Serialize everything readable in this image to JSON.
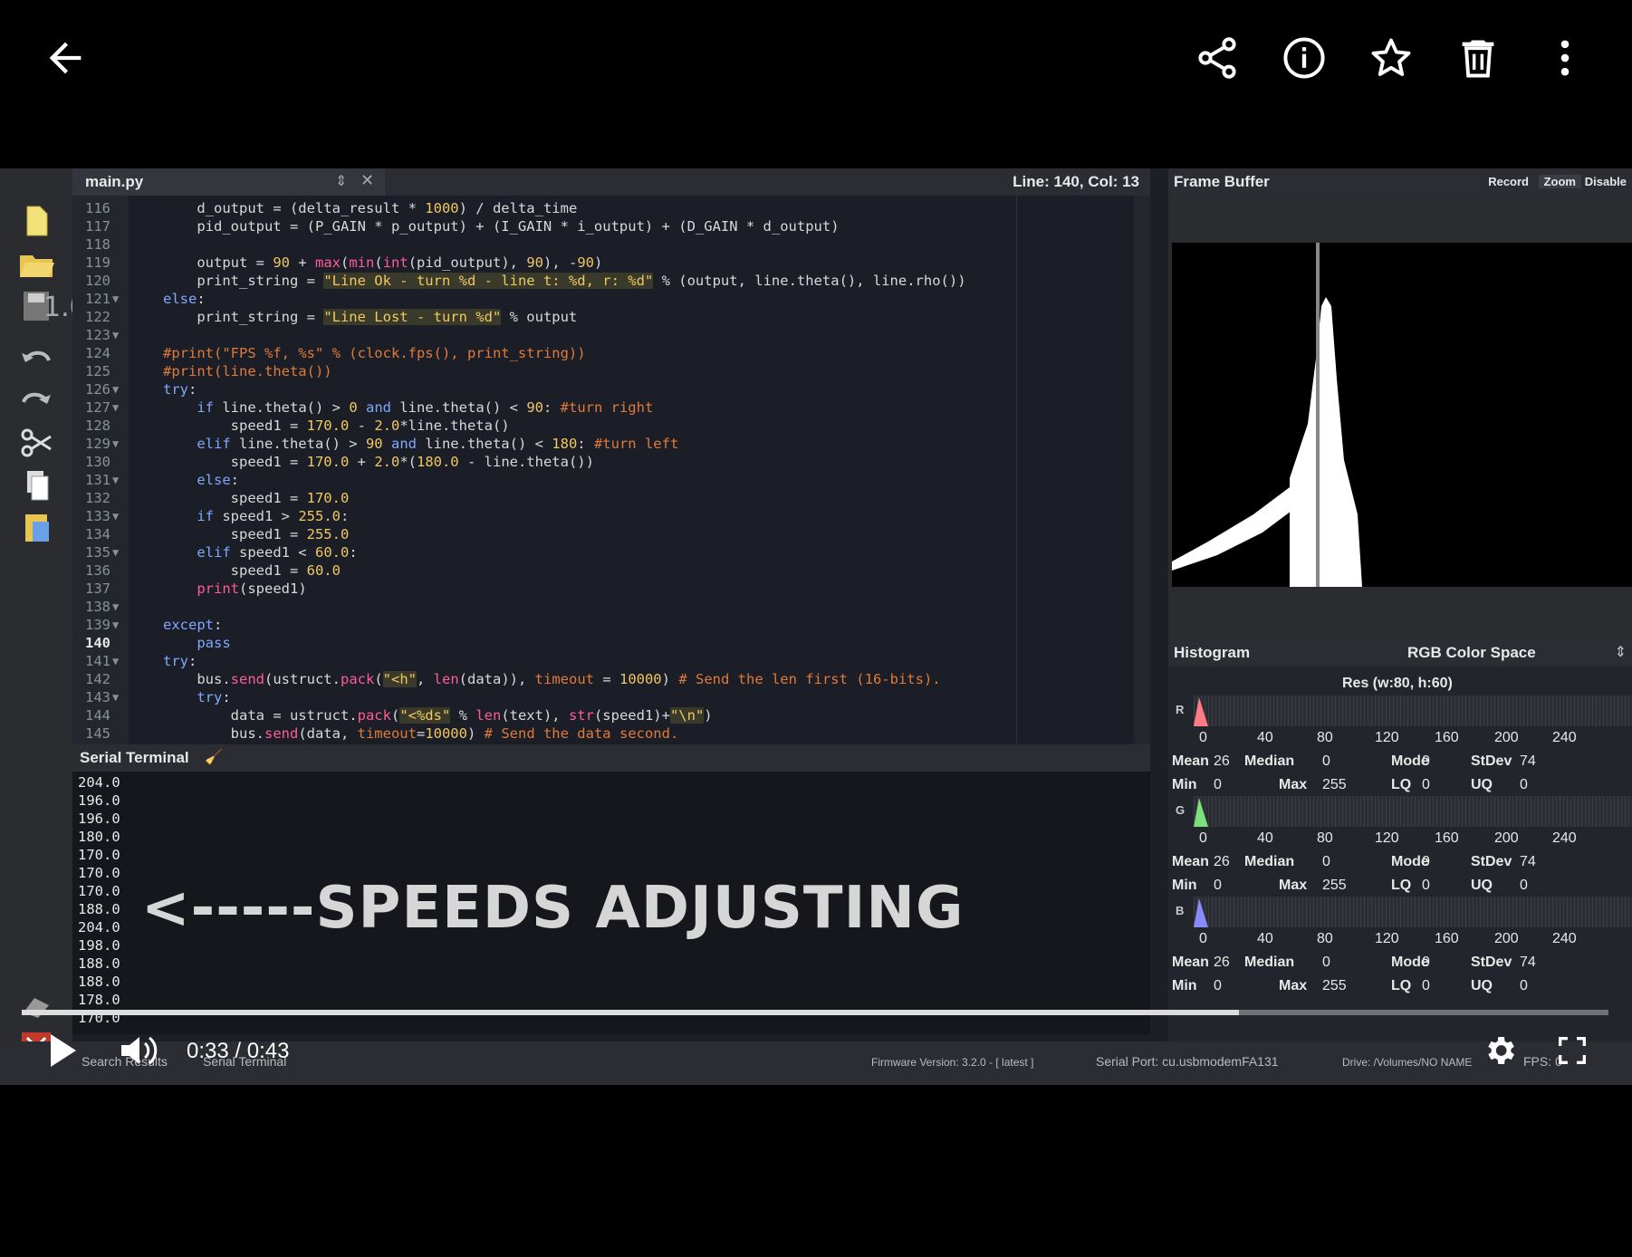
{
  "player": {
    "time": "0:33 / 0:43",
    "progress": 0.767,
    "icons": [
      "back-arrow-icon",
      "share-icon",
      "info-icon",
      "star-icon",
      "trash-icon",
      "more-vert-icon",
      "play-icon",
      "volume-icon",
      "settings-gear-icon",
      "fullscreen-icon"
    ]
  },
  "editor": {
    "tab": "main.py",
    "position": "Line: 140, Col: 13",
    "zoom_label": "1.00",
    "lines": [
      {
        "n": "116",
        "fold": "",
        "code": "    d_output = (delta_result * 1000) / delta_time"
      },
      {
        "n": "117",
        "fold": "",
        "code": "    pid_output = (P_GAIN * p_output) + (I_GAIN * i_output) + (D_GAIN * d_output)"
      },
      {
        "n": "118",
        "fold": "",
        "code": ""
      },
      {
        "n": "119",
        "fold": "",
        "code": "    output = 90 + max(min(int(pid_output), 90), -90)"
      },
      {
        "n": "120",
        "fold": "",
        "code": "    print_string = \"Line Ok - turn %d - line t: %d, r: %d\" % (output, line.theta(), line.rho())"
      },
      {
        "n": "121",
        "fold": "▼",
        "code": "else:"
      },
      {
        "n": "122",
        "fold": "",
        "code": "    print_string = \"Line Lost - turn %d\" % output"
      },
      {
        "n": "123",
        "fold": "▼",
        "code": ""
      },
      {
        "n": "124",
        "fold": "",
        "code": "#print(\"FPS %f, %s\" % (clock.fps(), print_string))"
      },
      {
        "n": "125",
        "fold": "",
        "code": "#print(line.theta())"
      },
      {
        "n": "126",
        "fold": "▼",
        "code": "try:"
      },
      {
        "n": "127",
        "fold": "▼",
        "code": "    if line.theta() > 0 and line.theta() < 90: #turn right"
      },
      {
        "n": "128",
        "fold": "",
        "code": "        speed1 = 170.0 - 2.0*line.theta()"
      },
      {
        "n": "129",
        "fold": "▼",
        "code": "    elif line.theta() > 90 and line.theta() < 180: #turn left"
      },
      {
        "n": "130",
        "fold": "",
        "code": "        speed1 = 170.0 + 2.0*(180.0 - line.theta())"
      },
      {
        "n": "131",
        "fold": "▼",
        "code": "    else:"
      },
      {
        "n": "132",
        "fold": "",
        "code": "        speed1 = 170.0"
      },
      {
        "n": "133",
        "fold": "▼",
        "code": "    if speed1 > 255.0:"
      },
      {
        "n": "134",
        "fold": "",
        "code": "        speed1 = 255.0"
      },
      {
        "n": "135",
        "fold": "▼",
        "code": "    elif speed1 < 60.0:"
      },
      {
        "n": "136",
        "fold": "",
        "code": "        speed1 = 60.0"
      },
      {
        "n": "137",
        "fold": "",
        "code": "    print(speed1)"
      },
      {
        "n": "138",
        "fold": "▼",
        "code": ""
      },
      {
        "n": "139",
        "fold": "▼",
        "code": "except:"
      },
      {
        "n": "140",
        "fold": "",
        "code": "    pass"
      },
      {
        "n": "141",
        "fold": "▼",
        "code": "try:"
      },
      {
        "n": "142",
        "fold": "",
        "code": "    bus.send(ustruct.pack(\"<h\", len(data)), timeout = 10000) # Send the len first (16-bits)."
      },
      {
        "n": "143",
        "fold": "▼",
        "code": "    try:"
      },
      {
        "n": "144",
        "fold": "",
        "code": "        data = ustruct.pack(\"<%ds\" % len(text), str(speed1)+\"\\n\")"
      },
      {
        "n": "145",
        "fold": "",
        "code": "        bus.send(data, timeout=10000) # Send the data second."
      }
    ]
  },
  "terminal": {
    "title": "Serial Terminal",
    "lines": [
      "204.0",
      "196.0",
      "196.0",
      "180.0",
      "170.0",
      "170.0",
      "170.0",
      "188.0",
      "204.0",
      "198.0",
      "188.0",
      "188.0",
      "178.0",
      "170.0"
    ],
    "overlay": "<-----SPEEDS ADJUSTING"
  },
  "framebuffer": {
    "title": "Frame Buffer",
    "buttons": [
      "Record",
      "Zoom",
      "Disable"
    ]
  },
  "histogram": {
    "title": "Histogram",
    "colorspace": "RGB Color Space",
    "res": "Res (w:80, h:60)",
    "ticks": [
      "0",
      "40",
      "80",
      "120",
      "160",
      "200",
      "240"
    ],
    "channels": [
      {
        "label": "R",
        "color": "#ff7b86",
        "mean": "26",
        "median": "0",
        "mode": "0",
        "stdev": "74",
        "min": "0",
        "max": "255",
        "lq": "0",
        "uq": "0"
      },
      {
        "label": "G",
        "color": "#7be07b",
        "mean": "26",
        "median": "0",
        "mode": "0",
        "stdev": "74",
        "min": "0",
        "max": "255",
        "lq": "0",
        "uq": "0"
      },
      {
        "label": "B",
        "color": "#8a8aff",
        "mean": "26",
        "median": "0",
        "mode": "0",
        "stdev": "74",
        "min": "0",
        "max": "255",
        "lq": "0",
        "uq": "0"
      }
    ],
    "stat_labels": {
      "mean": "Mean",
      "median": "Median",
      "mode": "Mode",
      "stdev": "StDev",
      "min": "Min",
      "max": "Max",
      "lq": "LQ",
      "uq": "UQ"
    }
  },
  "statusbar": {
    "search": "Search Results",
    "serial": "Serial Terminal",
    "firmware": "Firmware Version: 3.2.0 - [ latest ]",
    "port": "Serial Port: cu.usbmodemFA131",
    "drive": "Drive: /Volumes/NO NAME",
    "fps": "FPS: 0"
  }
}
